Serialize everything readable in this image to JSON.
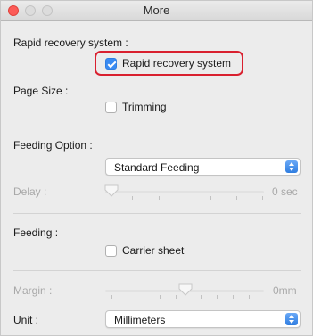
{
  "window": {
    "title": "More"
  },
  "rapid_recovery": {
    "section_label": "Rapid recovery system :",
    "checkbox_label": "Rapid recovery system",
    "checked": true
  },
  "page_size": {
    "section_label": "Page Size :",
    "trimming_label": "Trimming",
    "trimming_checked": false
  },
  "feeding_option": {
    "section_label": "Feeding Option :",
    "selected": "Standard Feeding"
  },
  "delay": {
    "label": "Delay :",
    "value_text": "0 sec",
    "enabled": false
  },
  "feeding": {
    "section_label": "Feeding :",
    "carrier_label": "Carrier sheet",
    "carrier_checked": false
  },
  "margin": {
    "label": "Margin :",
    "value_text": "0mm",
    "enabled": false
  },
  "unit": {
    "label": "Unit :",
    "selected": "Millimeters"
  },
  "colors": {
    "highlight": "#d9202f",
    "accent": "#3a8bf2"
  }
}
